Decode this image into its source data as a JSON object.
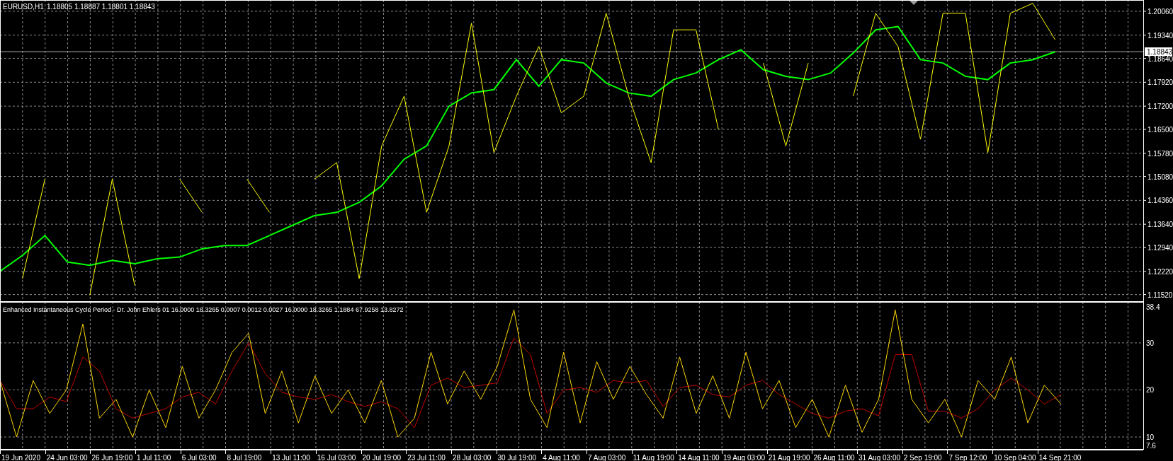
{
  "header": {
    "ohlc": "1.18805 1.18887 1.18801 1.18843"
  },
  "time_axis": [
    "19 Jun 2020",
    "24 Jun 03:00",
    "26 Jun 19:00",
    "1 Jul 11:00",
    "6 Jul 03:00",
    "8 Jul 19:00",
    "13 Jul 11:00",
    "16 Jul 03:00",
    "20 Jul 19:00",
    "23 Jul 11:00",
    "28 Jul 03:00",
    "30 Jul 19:00",
    "4 Aug 11:00",
    "7 Aug 03:00",
    "11 Aug 19:00",
    "14 Aug 11:00",
    "19 Aug 03:00",
    "21 Aug 19:00",
    "26 Aug 11:00",
    "31 Aug 03:00",
    "2 Sep 19:00",
    "7 Sep 12:00",
    "10 Sep 04:00",
    "14 Sep 21:00"
  ],
  "price_chart": {
    "chart_data": {
      "type": "line",
      "title": "EURUSD,H1",
      "grid": true,
      "ylim": [
        1.1132,
        1.204
      ],
      "ref_lines": [
        {
          "value": 1.18843,
          "axis": "y",
          "label": "1.18843"
        }
      ],
      "categories": [
        null,
        null,
        null,
        null,
        null,
        null,
        null,
        null,
        null,
        null,
        null,
        null,
        null,
        null,
        null,
        null,
        null,
        null,
        null,
        null,
        null,
        null,
        null,
        null,
        null,
        null,
        null,
        null,
        null,
        null,
        null,
        null,
        null,
        null,
        null,
        null,
        null,
        null,
        null,
        null,
        null,
        null,
        null,
        null,
        null,
        null,
        null,
        null
      ],
      "yticks": [
        {
          "value": 1.2006,
          "label": "1.20060"
        },
        {
          "value": 1.1934,
          "label": "1.19340"
        },
        {
          "value": 1.1864,
          "label": "1.18640"
        },
        {
          "value": 1.1792,
          "label": "1.17920"
        },
        {
          "value": 1.172,
          "label": "1.17200"
        },
        {
          "value": 1.165,
          "label": "1.16500"
        },
        {
          "value": 1.1578,
          "label": "1.15780"
        },
        {
          "value": 1.1508,
          "label": "1.15080"
        },
        {
          "value": 1.1436,
          "label": "1.14360"
        },
        {
          "value": 1.1364,
          "label": "1.13640"
        },
        {
          "value": 1.1294,
          "label": "1.12940"
        },
        {
          "value": 1.1222,
          "label": "1.12220"
        },
        {
          "value": 1.1152,
          "label": "1.11520"
        }
      ],
      "series": [
        {
          "color": "#00ff00",
          "values": [
            1.1222,
            1.127,
            1.133,
            1.125,
            1.124,
            1.1255,
            1.1245,
            1.126,
            1.1265,
            1.129,
            1.13,
            1.13,
            1.133,
            1.136,
            1.139,
            1.14,
            1.143,
            1.148,
            1.156,
            1.16,
            1.172,
            1.176,
            1.177,
            1.186,
            1.178,
            1.186,
            1.185,
            1.179,
            1.176,
            1.175,
            1.18,
            1.182,
            1.186,
            1.189,
            1.183,
            1.181,
            1.18,
            1.182,
            1.188,
            1.195,
            1.196,
            1.186,
            1.185,
            1.181,
            1.18,
            1.185,
            1.186,
            1.1884
          ]
        },
        {
          "color": "#ffff00",
          "values": [
            null,
            1.12,
            1.15,
            null,
            1.115,
            1.15,
            1.118,
            null,
            1.15,
            1.14,
            null,
            1.15,
            1.14,
            null,
            1.15,
            1.155,
            1.12,
            1.16,
            1.175,
            1.14,
            1.16,
            1.197,
            1.158,
            1.175,
            1.19,
            1.17,
            1.175,
            1.2,
            1.175,
            1.155,
            1.195,
            1.195,
            1.165,
            null,
            1.185,
            1.16,
            1.185,
            null,
            1.175,
            1.2,
            1.19,
            1.162,
            1.2,
            1.2,
            1.158,
            1.2,
            1.203,
            1.192
          ]
        }
      ]
    }
  },
  "indicator": {
    "chart_data": {
      "type": "line",
      "title": "Enhanced Instantaneous Cycle Period - Dr. John Ehlers 01 16.0000 18.3265 0.0007 0.0012 0.0027 16.0000 18.3265 1.1884 67.9258 13.8272",
      "grid": true,
      "ylim": [
        7.6,
        38.4
      ],
      "categories": [
        null,
        null,
        null,
        null,
        null,
        null,
        null,
        null,
        null,
        null,
        null,
        null,
        null,
        null,
        null,
        null,
        null,
        null,
        null,
        null,
        null,
        null,
        null,
        null,
        null,
        null,
        null,
        null,
        null,
        null,
        null,
        null,
        null,
        null,
        null,
        null,
        null,
        null,
        null,
        null,
        null,
        null,
        null,
        null,
        null,
        null,
        null,
        null,
        null,
        null,
        null,
        null,
        null,
        null,
        null,
        null,
        null,
        null,
        null,
        null,
        null,
        null,
        null,
        null,
        null
      ],
      "yticks": [
        {
          "value": 38.4,
          "label": "38.4"
        },
        {
          "value": 30,
          "label": "30"
        },
        {
          "value": 20,
          "label": "20"
        },
        {
          "value": 10,
          "label": "10"
        },
        {
          "value": 7.6,
          "label": "7.6"
        }
      ],
      "series": [
        {
          "color": "#c00000",
          "values": [
            22,
            16,
            16,
            18.5,
            17.5,
            27,
            24,
            16,
            14,
            15,
            16,
            18.5,
            19.5,
            17,
            24,
            30,
            23.5,
            19.5,
            18.5,
            18,
            19,
            17.5,
            16.5,
            17.5,
            16,
            12,
            21,
            22.5,
            20.5,
            21,
            21.5,
            31,
            27.5,
            15,
            20,
            20.5,
            19.5,
            22,
            21.5,
            22,
            16.5,
            20.5,
            21,
            19,
            18.5,
            21,
            22,
            19,
            17,
            15,
            14,
            15.5,
            16,
            14.5,
            27.5,
            27.5,
            15.5,
            15.5,
            14,
            16,
            20,
            22.5,
            20,
            17,
            19
          ]
        },
        {
          "color": "#ffd700",
          "values": [
            22,
            10,
            22,
            15,
            20,
            34,
            14,
            18,
            10,
            20,
            12,
            25,
            14,
            20,
            28,
            32,
            15,
            24,
            13,
            23,
            15,
            20,
            13,
            22,
            10,
            14,
            28,
            17,
            24,
            18,
            25,
            37,
            18,
            12,
            28,
            13,
            26,
            18,
            25,
            19,
            14,
            27,
            15,
            23,
            14,
            28,
            16,
            22,
            12,
            18,
            10,
            21,
            11,
            18,
            37,
            18,
            13,
            18,
            10,
            22,
            18,
            27,
            13,
            21,
            17
          ]
        }
      ]
    }
  }
}
